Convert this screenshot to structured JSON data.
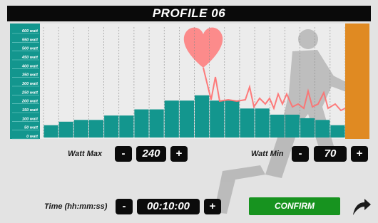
{
  "title": "PROFILE 06",
  "colors": {
    "bar": "#13968e",
    "axis_panel": "#13968e",
    "right_panel": "#e08a22",
    "pulse": "#ff6e6e",
    "confirm": "#17931f"
  },
  "controls": {
    "watt_max_label": "Watt Max",
    "watt_max_value": "240",
    "watt_min_label": "Watt Min",
    "watt_min_value": "70",
    "time_label": "Time (hh:mm:ss)",
    "time_value": "00:10:00",
    "minus": "-",
    "plus": "+",
    "confirm_label": "CONFIRM"
  },
  "chart_data": {
    "type": "bar",
    "ylabel": "",
    "ylim": [
      0,
      600
    ],
    "y_ticks": [
      "0 watt",
      "50 watt",
      "100 watt",
      "150 watt",
      "200 watt",
      "250 watt",
      "300 watt",
      "350 watt",
      "400 watt",
      "450 watt",
      "500 watt",
      "550 watt",
      "600 watt"
    ],
    "values": [
      70,
      90,
      100,
      100,
      125,
      125,
      160,
      160,
      210,
      210,
      240,
      210,
      210,
      165,
      165,
      130,
      130,
      110,
      100,
      70
    ],
    "grid": true
  }
}
